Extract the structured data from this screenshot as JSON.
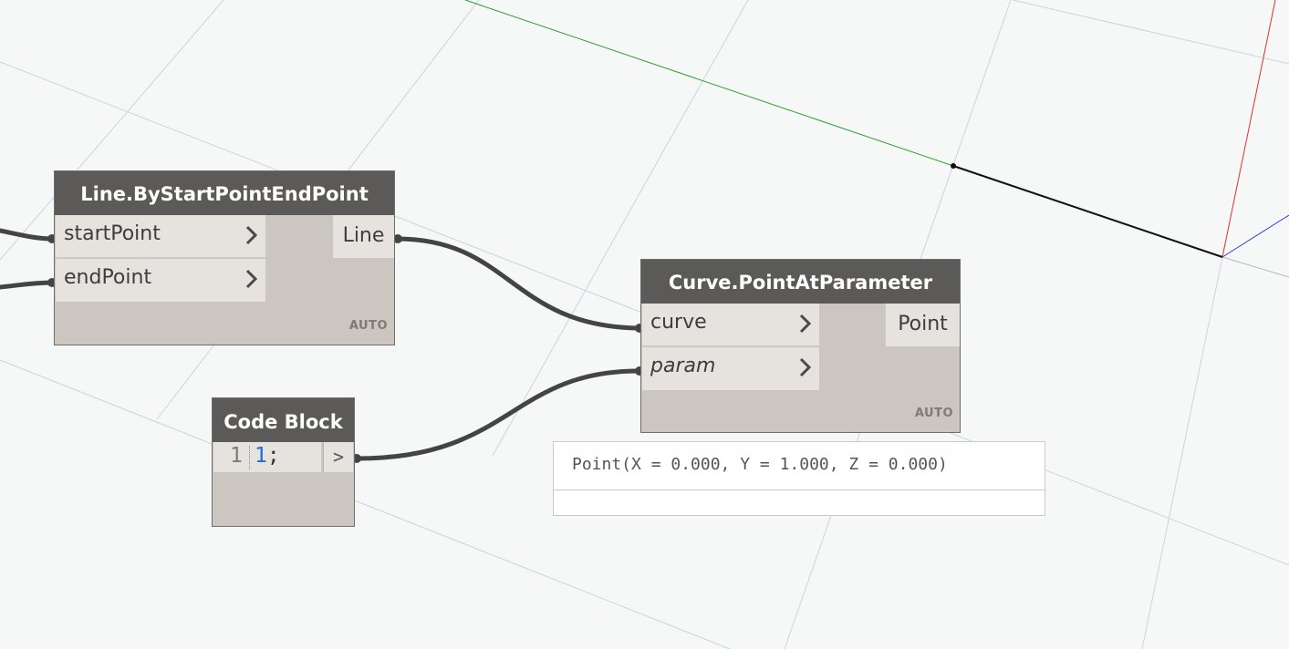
{
  "colors": {
    "background": "#f6f7f7",
    "node_body": "#cbc7c0",
    "node_header": "#5b5a58",
    "wire": "#444444",
    "code_number": "#1f6bd6",
    "axis_x": "#e03030",
    "axis_y": "#2e9e2e",
    "axis_z": "#3a3adf"
  },
  "nodes": {
    "line_node": {
      "title": "Line.ByStartPointEndPoint",
      "inputs": [
        "startPoint",
        "endPoint"
      ],
      "output": "Line",
      "lacing": "AUTO"
    },
    "curve_node": {
      "title": "Curve.PointAtParameter",
      "inputs": [
        "curve",
        "param"
      ],
      "output": "Point",
      "lacing": "AUTO"
    },
    "code_block": {
      "title": "Code Block",
      "line_number": "1",
      "code_value": "1",
      "code_terminator": ";",
      "output": ">"
    }
  },
  "preview": {
    "value": "Point(X = 0.000, Y = 1.000, Z = 0.000)"
  },
  "icons": {
    "input_port_chevron": "chevron-right-icon"
  }
}
